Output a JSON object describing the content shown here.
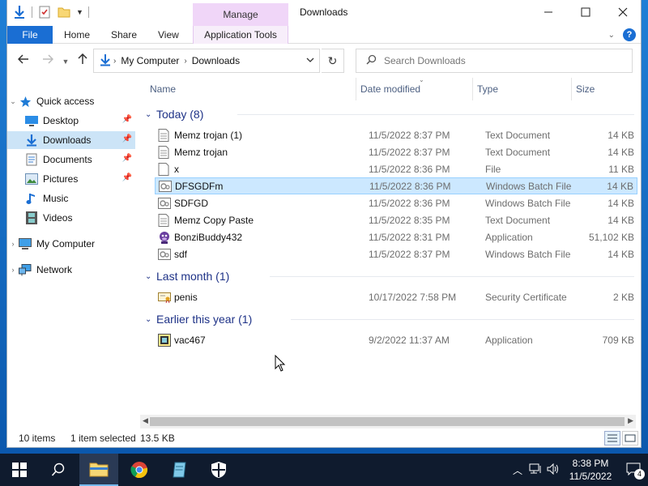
{
  "window": {
    "title": "Downloads",
    "manage_tab": "Manage",
    "ribbon_tabs": [
      "File",
      "Home",
      "Share",
      "View",
      "Application Tools"
    ],
    "help": "?"
  },
  "address": {
    "crumbs": [
      "My Computer",
      "Downloads"
    ],
    "search_placeholder": "Search Downloads"
  },
  "columns": {
    "name": "Name",
    "date": "Date modified",
    "type": "Type",
    "size": "Size"
  },
  "nav": {
    "quick_access": "Quick access",
    "items": [
      {
        "label": "Desktop",
        "icon": "desktop-icon",
        "pinned": true
      },
      {
        "label": "Downloads",
        "icon": "download-arrow-icon",
        "pinned": true
      },
      {
        "label": "Documents",
        "icon": "documents-icon",
        "pinned": true
      },
      {
        "label": "Pictures",
        "icon": "pictures-icon",
        "pinned": true
      },
      {
        "label": "Music",
        "icon": "music-note-icon",
        "pinned": false
      },
      {
        "label": "Videos",
        "icon": "video-film-icon",
        "pinned": false
      }
    ],
    "my_computer": "My Computer",
    "network": "Network"
  },
  "groups": [
    {
      "label": "Today (8)",
      "files": [
        {
          "name": "Memz trojan (1)",
          "date": "11/5/2022 8:37 PM",
          "type": "Text Document",
          "size": "14 KB",
          "icon": "text-file-icon"
        },
        {
          "name": "Memz trojan",
          "date": "11/5/2022 8:37 PM",
          "type": "Text Document",
          "size": "14 KB",
          "icon": "text-file-icon"
        },
        {
          "name": "x",
          "date": "11/5/2022 8:36 PM",
          "type": "File",
          "size": "11 KB",
          "icon": "blank-file-icon"
        },
        {
          "name": "DFSGDFm",
          "date": "11/5/2022 8:36 PM",
          "type": "Windows Batch File",
          "size": "14 KB",
          "icon": "batch-file-icon",
          "selected": true
        },
        {
          "name": "SDFGD",
          "date": "11/5/2022 8:36 PM",
          "type": "Windows Batch File",
          "size": "14 KB",
          "icon": "batch-file-icon"
        },
        {
          "name": "Memz Copy Paste",
          "date": "11/5/2022 8:35 PM",
          "type": "Text Document",
          "size": "14 KB",
          "icon": "text-file-icon"
        },
        {
          "name": "BonziBuddy432",
          "date": "11/5/2022 8:31 PM",
          "type": "Application",
          "size": "51,102 KB",
          "icon": "bonzi-app-icon"
        },
        {
          "name": "sdf",
          "date": "11/5/2022 8:37 PM",
          "type": "Windows Batch File",
          "size": "14 KB",
          "icon": "batch-file-icon"
        }
      ]
    },
    {
      "label": "Last month (1)",
      "files": [
        {
          "name": "penis",
          "date": "10/17/2022 7:58 PM",
          "type": "Security Certificate",
          "size": "2 KB",
          "icon": "certificate-icon"
        }
      ]
    },
    {
      "label": "Earlier this year (1)",
      "files": [
        {
          "name": "vac467",
          "date": "9/2/2022 11:37 AM",
          "type": "Application",
          "size": "709 KB",
          "icon": "app-icon"
        }
      ]
    }
  ],
  "status": {
    "count": "10 items",
    "selection": "1 item selected",
    "selection_size": "13.5 KB"
  },
  "taskbar": {
    "time": "8:38 PM",
    "date": "11/5/2022",
    "notifications": "4"
  },
  "colors": {
    "accent": "#1a6ed3",
    "selected_row": "#cce8ff",
    "manage_tab": "#f0d6f8",
    "group_header": "#1e3287"
  }
}
